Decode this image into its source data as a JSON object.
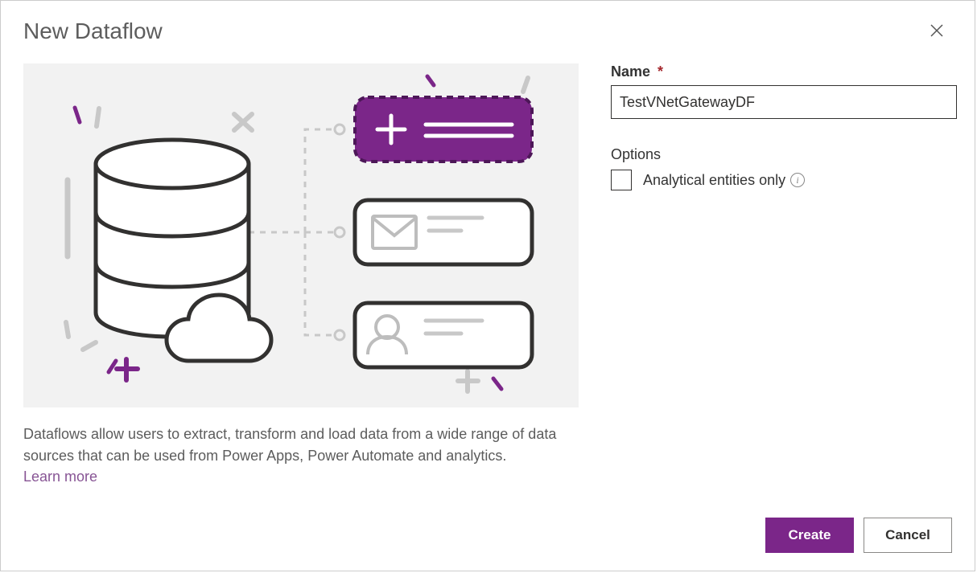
{
  "dialog": {
    "title": "New Dataflow",
    "description": "Dataflows allow users to extract, transform and load data from a wide range of data sources that can be used from Power Apps, Power Automate and analytics.",
    "learn_more_label": "Learn more"
  },
  "form": {
    "name_label": "Name",
    "name_required": "*",
    "name_value": "TestVNetGatewayDF",
    "options_label": "Options",
    "analytical_label": "Analytical entities only",
    "analytical_checked": false
  },
  "footer": {
    "create_label": "Create",
    "cancel_label": "Cancel"
  },
  "colors": {
    "accent": "#7B2689",
    "illustration_bg": "#f2f2f2"
  }
}
